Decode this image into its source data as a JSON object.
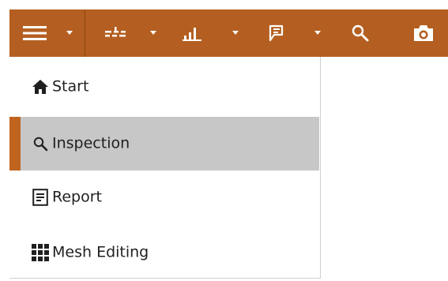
{
  "toolbar": {
    "background": "#b45f21",
    "items": [
      {
        "icon": "hamburger-menu-icon",
        "has_dropdown": true
      },
      {
        "icon": "alignment-icon",
        "has_dropdown": true
      },
      {
        "icon": "bar-chart-icon",
        "has_dropdown": true
      },
      {
        "icon": "flag-icon",
        "has_dropdown": true
      },
      {
        "icon": "search-icon",
        "has_dropdown": false
      },
      {
        "icon": "camera-icon",
        "has_dropdown": false
      }
    ]
  },
  "menu": {
    "accent_color": "#c0641f",
    "selected_background": "#c7c7c7",
    "items": [
      {
        "label": "Start",
        "icon": "home-icon",
        "selected": false
      },
      {
        "label": "Inspection",
        "icon": "search-icon",
        "selected": true
      },
      {
        "label": "Report",
        "icon": "report-icon",
        "selected": false
      },
      {
        "label": "Mesh Editing",
        "icon": "grid-icon",
        "selected": false
      }
    ]
  }
}
